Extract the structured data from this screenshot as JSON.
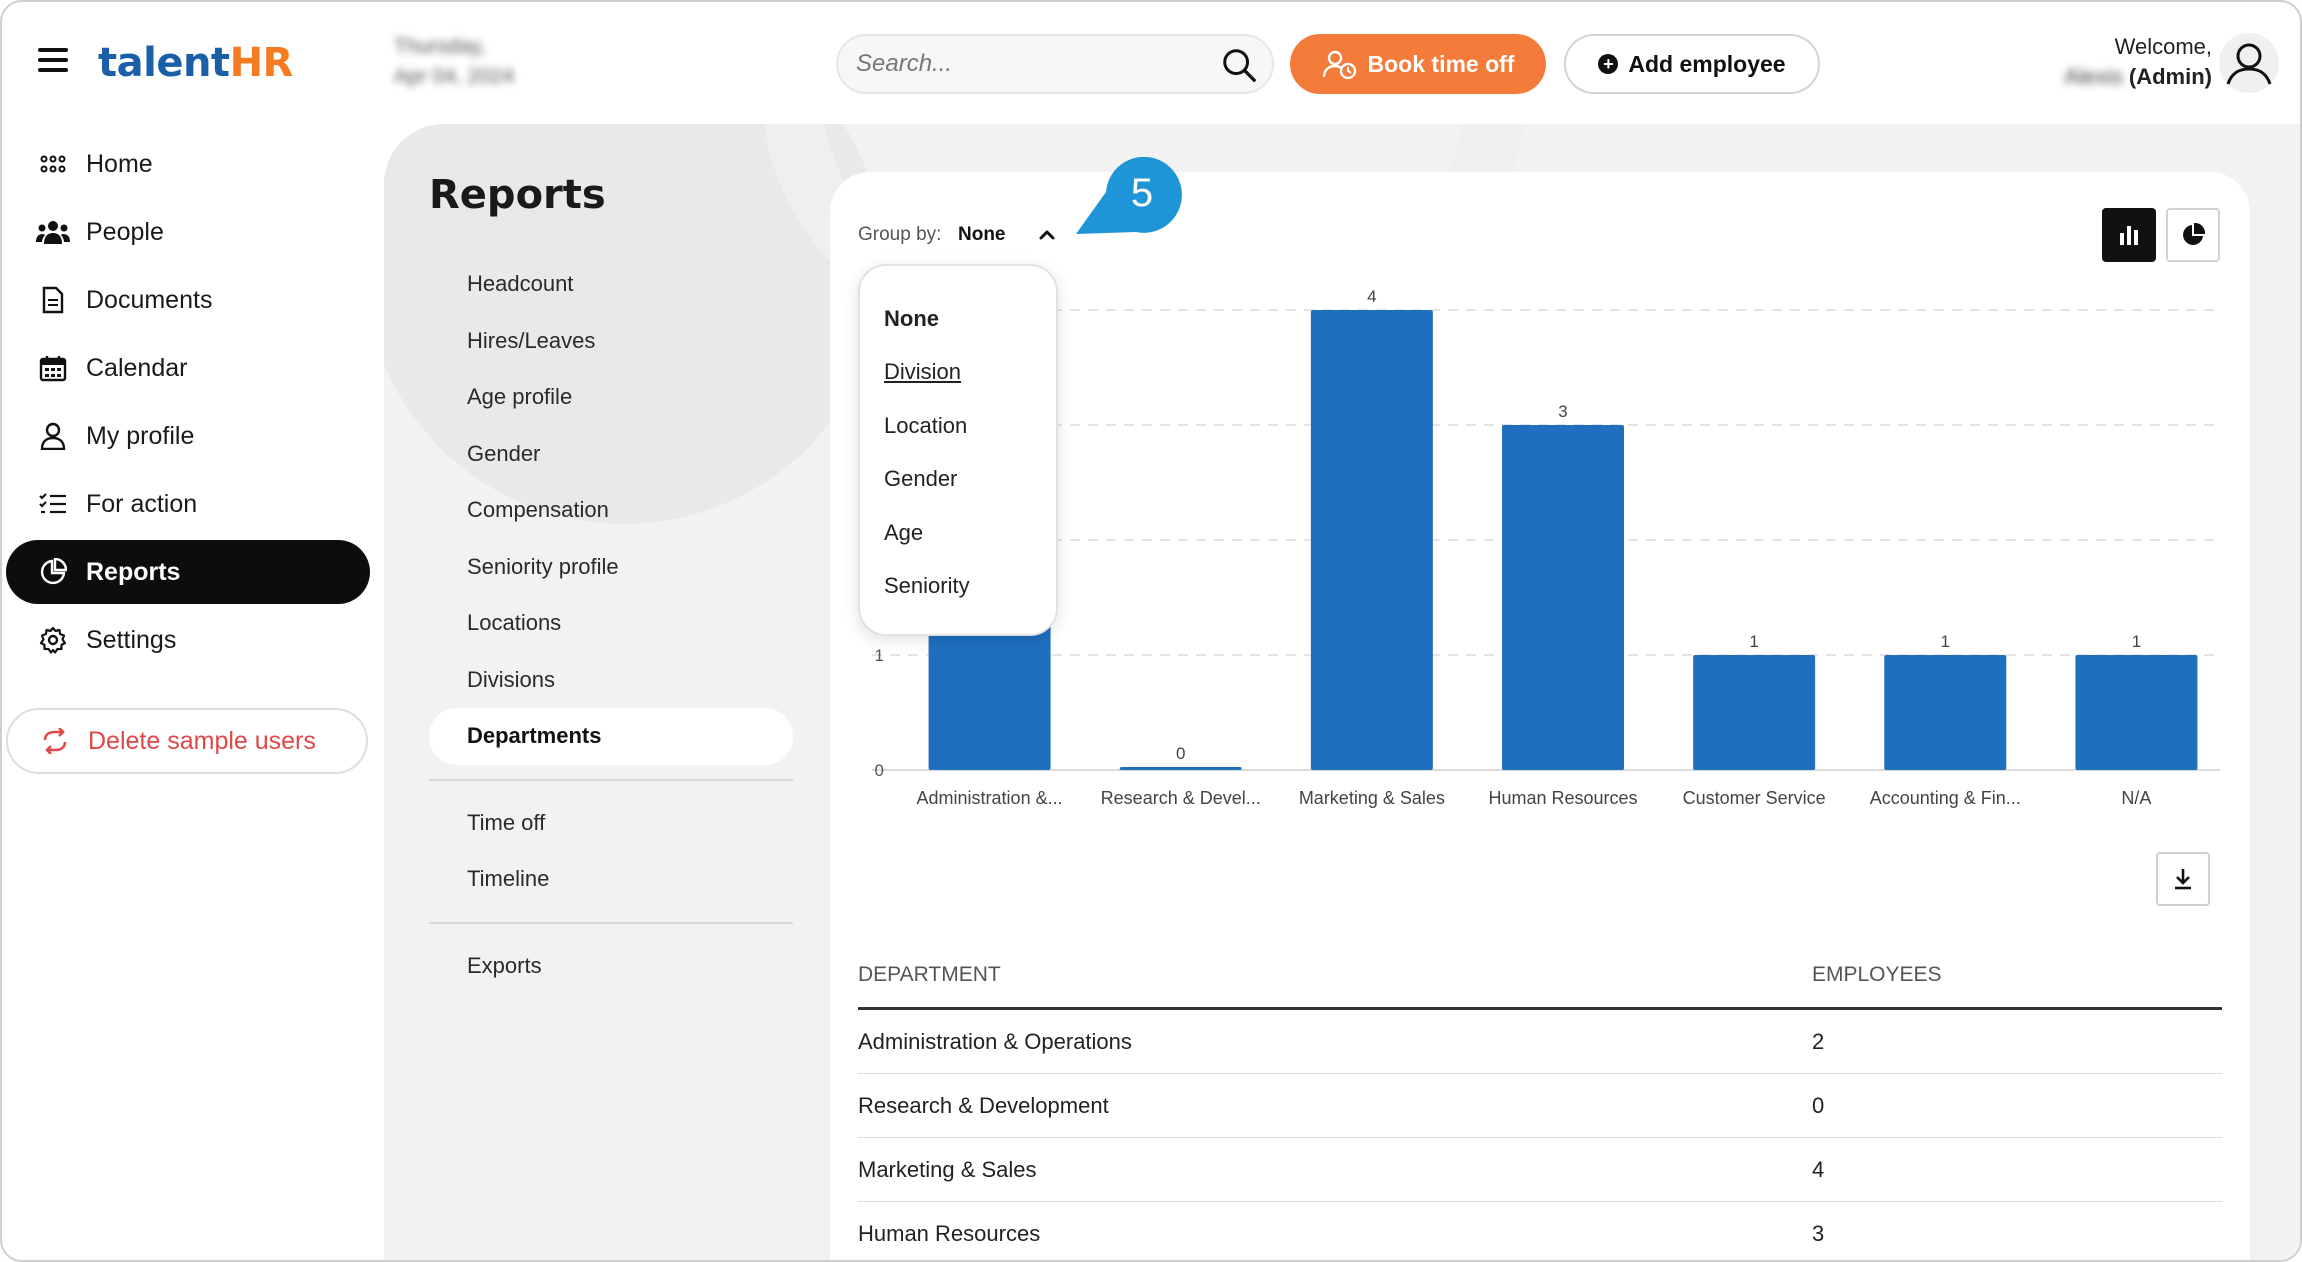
{
  "header": {
    "logo_part1": "talent",
    "logo_part2": "HR",
    "date_line1": "Thursday,",
    "date_line2": "Apr 04, 2024",
    "search_placeholder": "Search...",
    "book_time_off": "Book time off",
    "add_employee": "Add employee",
    "welcome": "Welcome,",
    "user_name": "Alexis",
    "user_role": "(Admin)"
  },
  "nav": {
    "items": [
      {
        "label": "Home",
        "icon": "grid-icon"
      },
      {
        "label": "People",
        "icon": "people-icon"
      },
      {
        "label": "Documents",
        "icon": "document-icon"
      },
      {
        "label": "Calendar",
        "icon": "calendar-icon"
      },
      {
        "label": "My profile",
        "icon": "user-icon"
      },
      {
        "label": "For action",
        "icon": "checklist-icon"
      },
      {
        "label": "Reports",
        "icon": "pie-chart-icon",
        "active": true
      },
      {
        "label": "Settings",
        "icon": "gear-icon"
      }
    ],
    "delete_sample": "Delete sample users"
  },
  "reports": {
    "title": "Reports",
    "subnav": [
      "Headcount",
      "Hires/Leaves",
      "Age profile",
      "Gender",
      "Compensation",
      "Seniority profile",
      "Locations",
      "Divisions",
      "Departments"
    ],
    "subnav_active": "Departments",
    "subnav2": [
      "Time off",
      "Timeline"
    ],
    "subnav3": [
      "Exports"
    ]
  },
  "groupby": {
    "label": "Group by:",
    "value": "None",
    "options": [
      "None",
      "Division",
      "Location",
      "Gender",
      "Age",
      "Seniority"
    ]
  },
  "callout": {
    "number": "5"
  },
  "chart_data": {
    "type": "bar",
    "categories": [
      "Administration &...",
      "Research & Devel...",
      "Marketing & Sales",
      "Human Resources",
      "Customer Service",
      "Accounting & Fin...",
      "N/A"
    ],
    "values": [
      2,
      0,
      4,
      3,
      1,
      1,
      1
    ],
    "ylim": [
      0,
      4
    ],
    "y_ticks": [
      "0",
      "1"
    ],
    "bar_color": "#1f6fbf",
    "grid": true
  },
  "table": {
    "headers": [
      "DEPARTMENT",
      "EMPLOYEES"
    ],
    "rows": [
      [
        "Administration & Operations",
        "2"
      ],
      [
        "Research & Development",
        "0"
      ],
      [
        "Marketing & Sales",
        "4"
      ],
      [
        "Human Resources",
        "3"
      ]
    ]
  },
  "colors": {
    "accent_orange": "#f47b3a",
    "brand_blue": "#1a5fa8",
    "callout_blue": "#1e95d6",
    "danger": "#e04848"
  }
}
